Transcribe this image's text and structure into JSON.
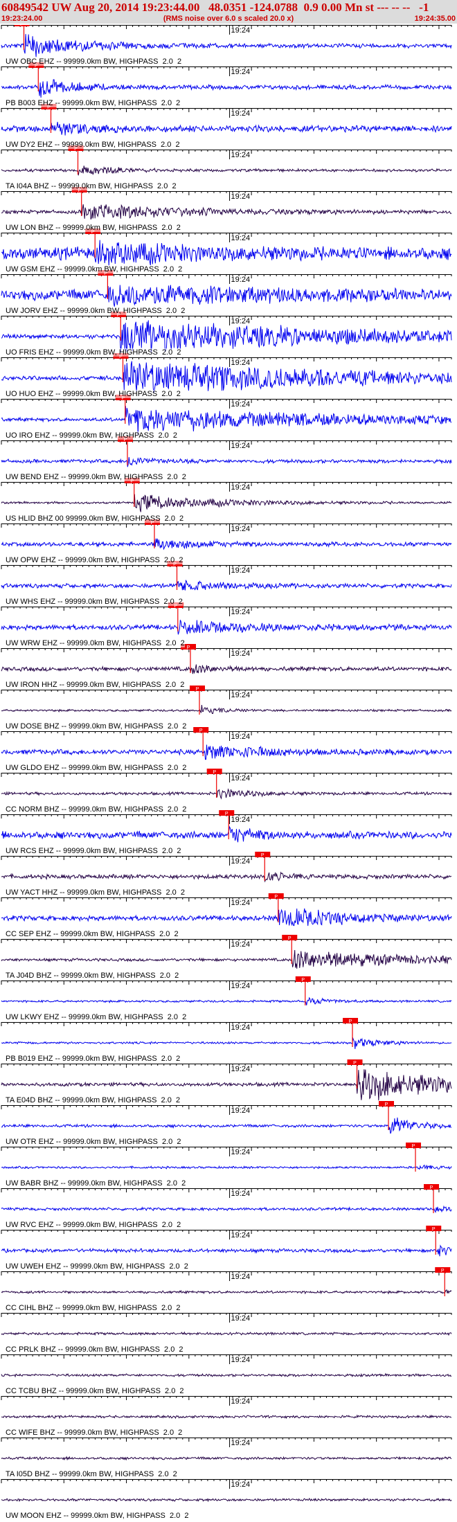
{
  "header": {
    "title": "60849542 UW Aug 20, 2014 19:23:44.00   48.0351 -124.0788  0.9 0.00 Mn st --- -- --   -1",
    "start_time": "19:23:24.00",
    "rms_note": "(RMS noise over 6.0 s scaled 20.0 x)",
    "end_time": "19:24:35.00"
  },
  "chart_data": {
    "type": "line",
    "time_range": [
      "19:23:24.00",
      "19:24:35.00"
    ],
    "minute_mark_label": "19:24",
    "pick_label": "P",
    "colors": {
      "blue": "#0000ee",
      "dark": "#220044",
      "pick": "#ee0000",
      "axis": "#000000"
    },
    "series": [
      {
        "name": "UW OBC EHZ -- 99999.0km BW, HIGHPASS  2.0  2",
        "color": "blue",
        "amp": 0.12,
        "pick": 0.05,
        "burst": 0.6,
        "burst_len": 0.14
      },
      {
        "name": "PB B003 EHZ -- 99999.0km BW, HIGHPASS  2.0  2",
        "color": "blue",
        "amp": 0.12,
        "pick": 0.082,
        "burst": 0.5,
        "burst_len": 0.08
      },
      {
        "name": "UW DY2 EHZ -- 99999.0km BW, HIGHPASS  2.0  2",
        "color": "blue",
        "amp": 0.18,
        "pick": 0.11,
        "burst": 0.35,
        "burst_len": 0.08
      },
      {
        "name": "TA I04A BHZ -- 99999.0km BW, HIGHPASS  2.0  2",
        "color": "dark",
        "amp": 0.08,
        "pick": 0.17,
        "burst": 0.3,
        "burst_len": 0.08
      },
      {
        "name": "UW LON BHZ -- 99999.0km BW, HIGHPASS  2.0  2",
        "color": "dark",
        "amp": 0.1,
        "pick": 0.178,
        "burst": 0.45,
        "burst_len": 0.25
      },
      {
        "name": "UW GSM EHZ -- 99999.0km BW, HIGHPASS  2.0  2",
        "color": "blue",
        "amp": 0.35,
        "pick": 0.208,
        "burst": 0.6,
        "burst_len": 0.2
      },
      {
        "name": "UW JORV EHZ -- 99999.0km BW, HIGHPASS  2.0  2",
        "color": "blue",
        "amp": 0.3,
        "pick": 0.236,
        "burst": 0.5,
        "burst_len": 0.35
      },
      {
        "name": "UO FRIS EHZ -- 99999.0km BW, HIGHPASS  2.0  2",
        "color": "blue",
        "amp": 0.12,
        "pick": 0.265,
        "burst": 0.9,
        "burst_len": 0.6
      },
      {
        "name": "UO HUO EHZ -- 99999.0km BW, HIGHPASS  2.0  2",
        "color": "blue",
        "amp": 0.12,
        "pick": 0.27,
        "burst": 0.9,
        "burst_len": 0.6
      },
      {
        "name": "UO IRO EHZ -- 99999.0km BW, HIGHPASS  2.0  2",
        "color": "blue",
        "amp": 0.1,
        "pick": 0.275,
        "burst": 0.7,
        "burst_len": 0.5
      },
      {
        "name": "UW BEND EHZ -- 99999.0km BW, HIGHPASS  2.0  2",
        "color": "blue",
        "amp": 0.1,
        "pick": 0.28,
        "burst": 0.25,
        "burst_len": 0.06
      },
      {
        "name": "US HLID BHZ 00 99999.0km BW, HIGHPASS  2.0  2",
        "color": "dark",
        "amp": 0.06,
        "pick": 0.295,
        "burst": 0.45,
        "burst_len": 0.2
      },
      {
        "name": "UW OPW EHZ -- 99999.0km BW, HIGHPASS  2.0  2",
        "color": "blue",
        "amp": 0.12,
        "pick": 0.34,
        "burst": 0.3,
        "burst_len": 0.1
      },
      {
        "name": "UW WHS EHZ -- 99999.0km BW, HIGHPASS  2.0  2",
        "color": "blue",
        "amp": 0.12,
        "pick": 0.39,
        "burst": 0.25,
        "burst_len": 0.12
      },
      {
        "name": "UW WRW EHZ -- 99999.0km BW, HIGHPASS  2.0  2",
        "color": "blue",
        "amp": 0.14,
        "pick": 0.392,
        "burst": 0.35,
        "burst_len": 0.18
      },
      {
        "name": "UW IRON HHZ -- 99999.0km BW, HIGHPASS  2.0  2",
        "color": "dark",
        "amp": 0.12,
        "pick": 0.42,
        "burst": 0.3,
        "burst_len": 0.05
      },
      {
        "name": "UW DOSE BHZ -- 99999.0km BW, HIGHPASS  2.0  2",
        "color": "dark",
        "amp": 0.06,
        "pick": 0.44,
        "burst": 0.25,
        "burst_len": 0.05
      },
      {
        "name": "UW GLDO EHZ -- 99999.0km BW, HIGHPASS  2.0  2",
        "color": "blue",
        "amp": 0.14,
        "pick": 0.448,
        "burst": 0.4,
        "burst_len": 0.15
      },
      {
        "name": "CC NORM BHZ -- 99999.0km BW, HIGHPASS  2.0  2",
        "color": "dark",
        "amp": 0.08,
        "pick": 0.478,
        "burst": 0.3,
        "burst_len": 0.08
      },
      {
        "name": "UW RCS EHZ -- 99999.0km BW, HIGHPASS  2.0  2",
        "color": "blue",
        "amp": 0.2,
        "pick": 0.505,
        "burst": 0.45,
        "burst_len": 0.06
      },
      {
        "name": "UW YACT HHZ -- 99999.0km BW, HIGHPASS  2.0  2",
        "color": "dark",
        "amp": 0.12,
        "pick": 0.585,
        "burst": 0.3,
        "burst_len": 0.04
      },
      {
        "name": "CC SEP EHZ -- 99999.0km BW, HIGHPASS  2.0  2",
        "color": "blue",
        "amp": 0.14,
        "pick": 0.615,
        "burst": 0.55,
        "burst_len": 0.16
      },
      {
        "name": "TA J04D BHZ -- 99999.0km BW, HIGHPASS  2.0  2",
        "color": "dark",
        "amp": 0.08,
        "pick": 0.645,
        "burst": 0.6,
        "burst_len": 0.25
      },
      {
        "name": "UW LKWY EHZ -- 99999.0km BW, HIGHPASS  2.0  2",
        "color": "blue",
        "amp": 0.06,
        "pick": 0.675,
        "burst": 0.2,
        "burst_len": 0.06
      },
      {
        "name": "PB B019 EHZ -- 99999.0km BW, HIGHPASS  2.0  2",
        "color": "blue",
        "amp": 0.06,
        "pick": 0.78,
        "burst": 0.35,
        "burst_len": 0.06
      },
      {
        "name": "TA E04D BHZ -- 99999.0km BW, HIGHPASS  2.0  2",
        "color": "dark",
        "amp": 0.1,
        "pick": 0.79,
        "burst": 0.95,
        "burst_len": 0.25
      },
      {
        "name": "UW OTR EHZ -- 99999.0km BW, HIGHPASS  2.0  2",
        "color": "blue",
        "amp": 0.08,
        "pick": 0.86,
        "burst": 0.6,
        "burst_len": 0.06
      },
      {
        "name": "UW BABR BHZ -- 99999.0km BW, HIGHPASS  2.0  2",
        "color": "blue",
        "amp": 0.06,
        "pick": 0.92,
        "burst": 0.15,
        "burst_len": 0.04
      },
      {
        "name": "UW RVC EHZ -- 99999.0km BW, HIGHPASS  2.0  2",
        "color": "blue",
        "amp": 0.08,
        "pick": 0.96,
        "burst": 0.2,
        "burst_len": 0.04
      },
      {
        "name": "UW UWEH EHZ -- 99999.0km BW, HIGHPASS  2.0  2",
        "color": "blue",
        "amp": 0.1,
        "pick": 0.965,
        "burst": 0.3,
        "burst_len": 0.04
      },
      {
        "name": "CC CIHL BHZ -- 99999.0km BW, HIGHPASS  2.0  2",
        "color": "dark",
        "amp": 0.07,
        "pick": 0.985,
        "burst": 0.08,
        "burst_len": 0.02
      },
      {
        "name": "CC PRLK BHZ -- 99999.0km BW, HIGHPASS  2.0  2",
        "color": "dark",
        "amp": 0.07,
        "pick": null,
        "burst": 0,
        "burst_len": 0
      },
      {
        "name": "CC TCBU BHZ -- 99999.0km BW, HIGHPASS  2.0  2",
        "color": "dark",
        "amp": 0.07,
        "pick": null,
        "burst": 0,
        "burst_len": 0
      },
      {
        "name": "CC WIFE BHZ -- 99999.0km BW, HIGHPASS  2.0  2",
        "color": "dark",
        "amp": 0.07,
        "pick": null,
        "burst": 0,
        "burst_len": 0
      },
      {
        "name": "TA I05D BHZ -- 99999.0km BW, HIGHPASS  2.0  2",
        "color": "dark",
        "amp": 0.07,
        "pick": null,
        "burst": 0,
        "burst_len": 0
      },
      {
        "name": "UW MOON EHZ -- 99999.0km BW, HIGHPASS  2.0  2",
        "color": "dark",
        "amp": 0.07,
        "pick": null,
        "burst": 0,
        "burst_len": 0
      }
    ]
  }
}
